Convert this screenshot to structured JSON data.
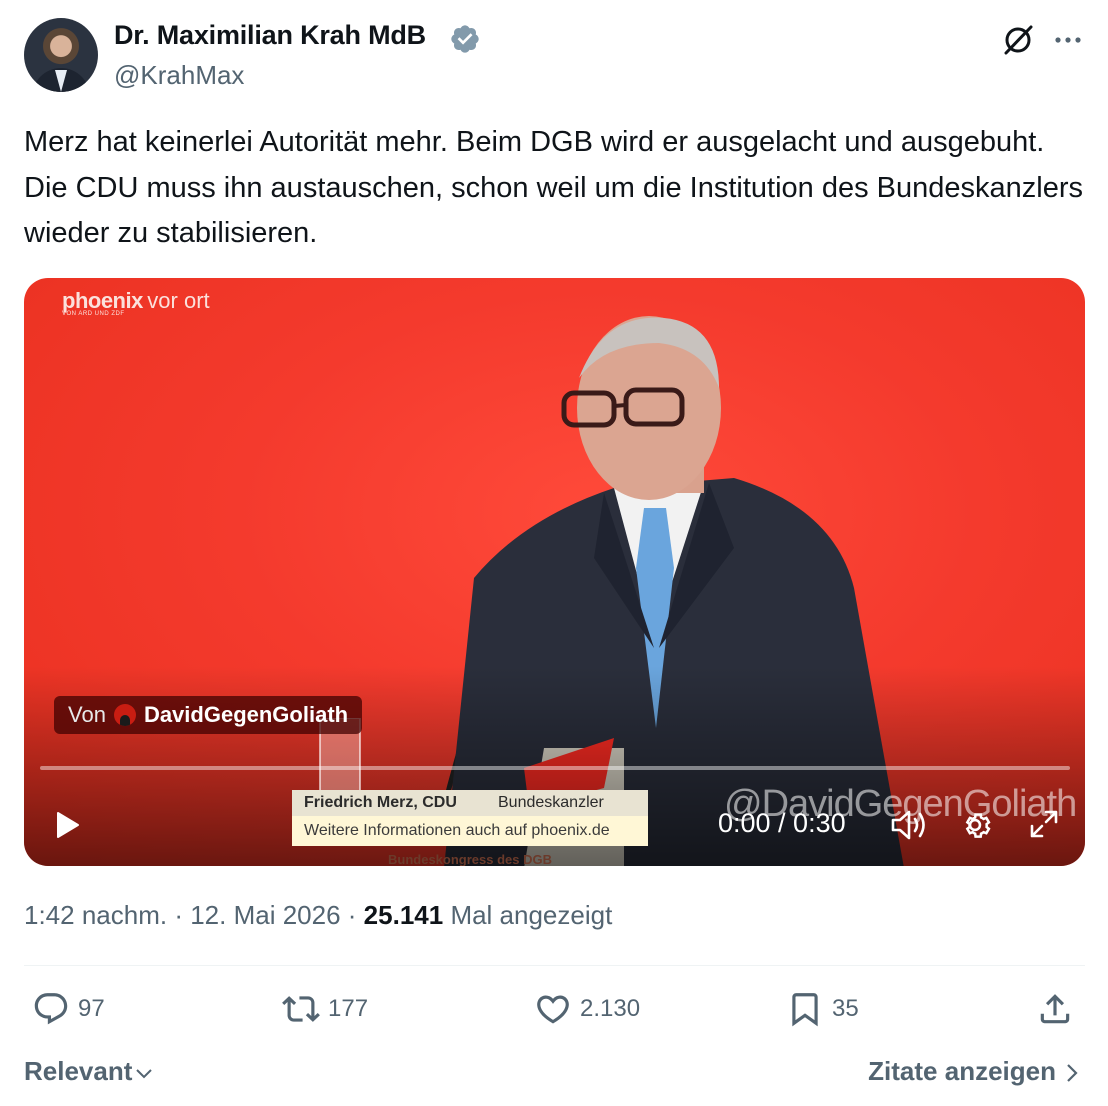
{
  "author": {
    "name": "Dr. Maximilian Krah MdB",
    "handle": "@KrahMax",
    "verified": true,
    "verified_color": "#829aab"
  },
  "header_icons": [
    "grok-icon",
    "more-icon"
  ],
  "tweet": {
    "text": "Merz hat keinerlei Autorität mehr. Beim DGB wird er ausgelacht und ausgebuht. Die CDU muss ihn austauschen, schon weil um die Institution des Bundeskanzlers wieder zu stabilisieren."
  },
  "media": {
    "channel_logo": "phoenix",
    "channel_suffix": "vor ort",
    "channel_sub": "VON ARD UND ZDF",
    "lower_third_name": "Friedrich Merz, CDU",
    "lower_third_role": "Bundeskanzler",
    "lower_third_info": "Weitere Informationen auch auf phoenix.de",
    "congress_text": "Bundeskongress des DGB",
    "watermark": "@DavidGegenGoliath",
    "via_label": "Von",
    "via_name": "DavidGegenGoliath",
    "timecode": "0:00 / 0:30",
    "progress": 0.0,
    "background_color": "#f43a2d"
  },
  "meta": {
    "time": "1:42 nachm.",
    "date": "12. Mai 2026",
    "views": "25.141",
    "views_label": "Mal angezeigt"
  },
  "actions": {
    "replies": "97",
    "reposts": "177",
    "likes": "2.130",
    "bookmarks": "35"
  },
  "footer": {
    "sort_label": "Relevant",
    "quotes_label": "Zitate anzeigen"
  }
}
